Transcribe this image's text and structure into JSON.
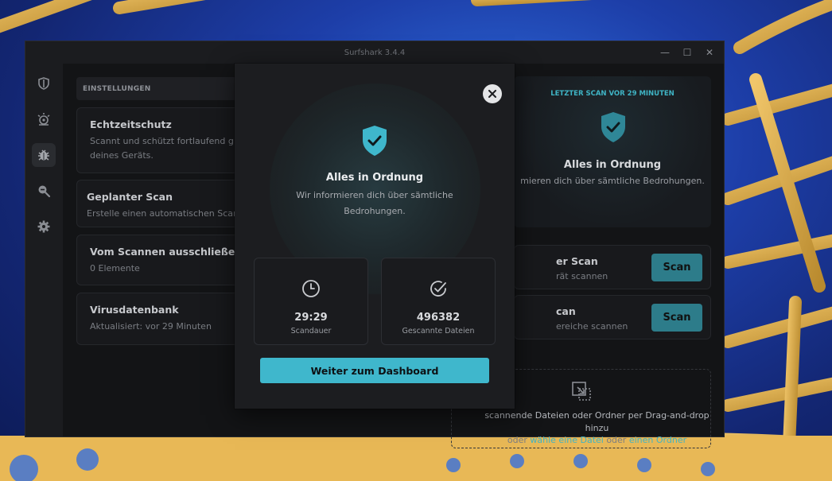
{
  "window": {
    "title": "Surfshark 3.4.4",
    "minimize_glyph": "—",
    "maximize_glyph": "☐",
    "close_glyph": "✕"
  },
  "nav": {
    "items": [
      {
        "icon": "shield-icon",
        "active": false
      },
      {
        "icon": "alert-icon",
        "active": false
      },
      {
        "icon": "bug-icon",
        "active": true
      },
      {
        "icon": "search-zoom-icon",
        "active": false
      },
      {
        "icon": "gear-icon",
        "active": false
      }
    ]
  },
  "settings": {
    "header": "EINSTELLUNGEN",
    "cards": [
      {
        "title": "Echtzeitschutz",
        "subtitle_line1": "Scannt und schützt fortlaufend gef",
        "subtitle_line2": "deines Geräts."
      },
      {
        "title": "Geplanter Scan",
        "subtitle": "Erstelle einen automatischen Scan-I"
      },
      {
        "title": "Vom Scannen ausschließen",
        "subtitle": "0 Elemente"
      },
      {
        "title": "Virusdatenbank",
        "subtitle": "Aktualisiert: vor 29 Minuten"
      }
    ]
  },
  "scan_panel": {
    "last_scan": "LETZTER SCAN VOR 29 MINUTEN",
    "status": "Alles in Ordnung",
    "info": "mieren dich über sämtliche Bedrohungen.",
    "rows": [
      {
        "title": "er Scan",
        "subtitle": "rät scannen",
        "button": "Scan"
      },
      {
        "title": "can",
        "subtitle": "ereiche scannen",
        "button": "Scan"
      }
    ],
    "dropzone": {
      "text": "scannende Dateien oder Ordner per Drag-and-drop hinzu",
      "alt_prefix": "oder",
      "link_file": "wähle eine Datei",
      "alt_mid": "oder",
      "link_folder": "einen Ordner"
    }
  },
  "modal": {
    "status": "Alles in Ordnung",
    "info": "Wir informieren dich über sämtliche Bedrohungen.",
    "stats": [
      {
        "value": "29:29",
        "label": "Scandauer",
        "icon": "clock-icon"
      },
      {
        "value": "496382",
        "label": "Gescannte Dateien",
        "icon": "check-circle-icon"
      }
    ],
    "button": "Weiter zum Dashboard"
  },
  "colors": {
    "accent": "#3fb7cc",
    "scan_button": "#2d7c8a",
    "window_bg": "#1b1c1f",
    "content_bg": "#131416"
  }
}
